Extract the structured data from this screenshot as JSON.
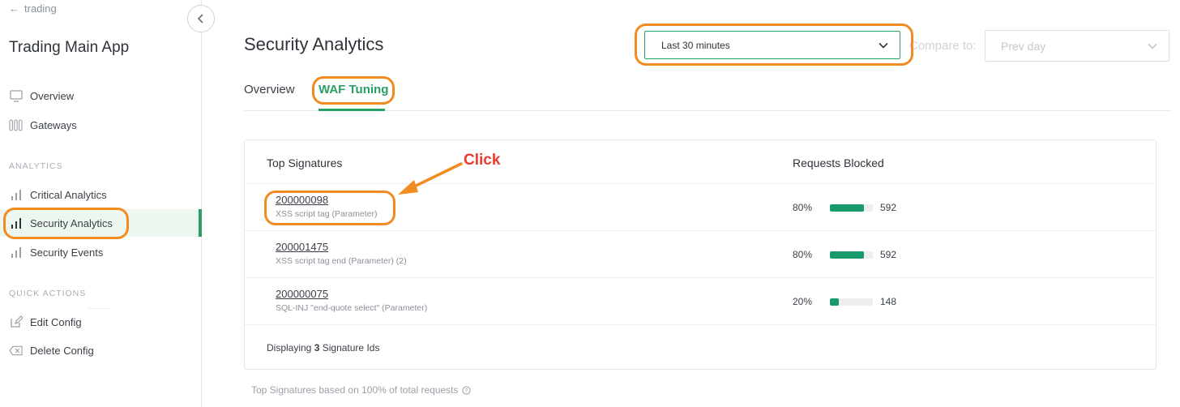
{
  "sidebar": {
    "back_label": "trading",
    "app_title": "Trading Main App",
    "items": [
      {
        "label": "Overview",
        "icon": "monitor-icon"
      },
      {
        "label": "Gateways",
        "icon": "gateways-icon"
      }
    ],
    "analytics_label": "ANALYTICS",
    "analytics_items": [
      {
        "label": "Critical Analytics",
        "icon": "bar-chart-icon"
      },
      {
        "label": "Security Analytics",
        "icon": "bar-chart-icon",
        "active": true
      },
      {
        "label": "Security Events",
        "icon": "bar-chart-icon"
      }
    ],
    "quick_actions_label": "QUICK ACTIONS",
    "quick_actions": [
      {
        "label": "Edit Config",
        "icon": "edit-icon"
      },
      {
        "label": "Delete Config",
        "icon": "delete-icon"
      }
    ]
  },
  "header": {
    "title": "Security Analytics",
    "time_range": "Last 30 minutes",
    "compare_label": "Compare to:",
    "compare_value": "Prev day"
  },
  "tabs": [
    {
      "label": "Overview",
      "active": false
    },
    {
      "label": "WAF Tuning",
      "active": true
    }
  ],
  "table": {
    "col_signatures": "Top Signatures",
    "col_requests": "Requests Blocked",
    "rows": [
      {
        "id": "200000098",
        "desc": "XSS script tag (Parameter)",
        "pct": "80%",
        "fraction": 0.8,
        "count": "592"
      },
      {
        "id": "200001475",
        "desc": "XSS script tag end (Parameter) (2)",
        "pct": "80%",
        "fraction": 0.8,
        "count": "592"
      },
      {
        "id": "200000075",
        "desc": "SQL-INJ \"end-quote select\" (Parameter)",
        "pct": "20%",
        "fraction": 0.2,
        "count": "148"
      }
    ],
    "displaying_prefix": "Displaying",
    "displaying_count": "3",
    "displaying_suffix": "Signature Ids"
  },
  "footnote": "Top Signatures based on 100% of total requests",
  "annotation": {
    "click_label": "Click"
  },
  "colors": {
    "accent": "#27a065",
    "bar": "#1a9b6c",
    "highlight": "#f28b20",
    "click_text": "#ef3b2d"
  }
}
